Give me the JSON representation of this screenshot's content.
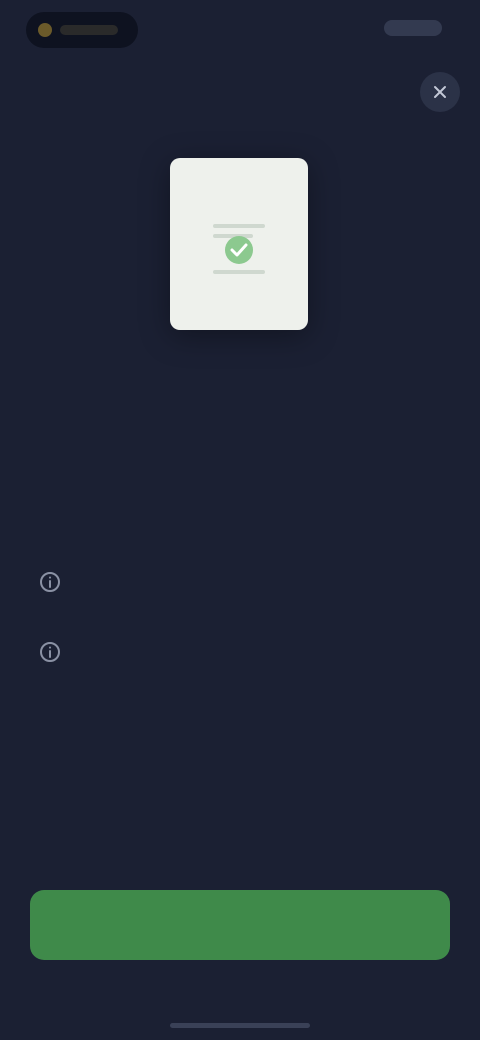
{
  "status_bar": {
    "time": "",
    "right_indicators": ""
  },
  "close_button": {
    "icon": "close-icon"
  },
  "document": {
    "icon": "document-icon",
    "accent_color": "#5aa85f"
  },
  "title": "",
  "subtitle": "",
  "info_items": [
    {
      "icon": "info-icon",
      "heading": "",
      "description": ""
    },
    {
      "icon": "info-icon",
      "heading": "",
      "description": ""
    }
  ],
  "primary_button": {
    "label": "",
    "color": "#3f8a4a"
  },
  "colors": {
    "background": "#1b2033",
    "accent": "#3f8a4a"
  }
}
